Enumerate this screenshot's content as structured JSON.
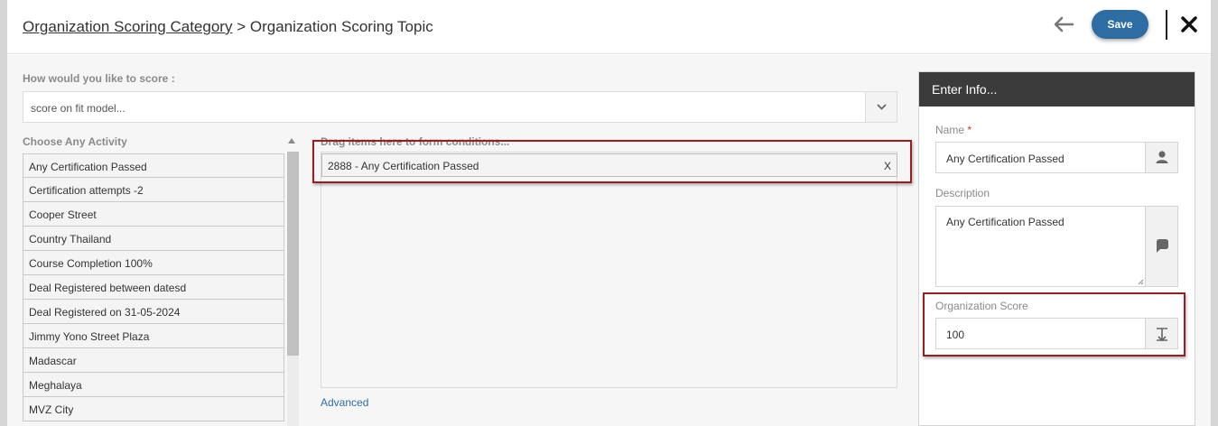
{
  "header": {
    "breadcrumb_parent": "Organization Scoring Category",
    "breadcrumb_separator": ">",
    "breadcrumb_current": "Organization Scoring Topic",
    "save_label": "Save"
  },
  "scoring": {
    "question_label": "How would you like to score :",
    "selected_value": "score on fit model..."
  },
  "activities": {
    "label": "Choose Any Activity",
    "items": [
      "Any Certification Passed",
      "Certification attempts -2",
      "Cooper Street",
      "Country Thailand",
      "Course Completion 100%",
      "Deal Registered between datesd",
      "Deal Registered on 31-05-2024",
      "Jimmy Yono Street Plaza",
      "Madascar",
      "Meghalaya",
      "MVZ City"
    ]
  },
  "conditions": {
    "label": "Drag items here to form conditions...",
    "items": [
      {
        "text": "2888 - Any Certification Passed",
        "remove_label": "X"
      }
    ],
    "advanced_label": "Advanced"
  },
  "info": {
    "title": "Enter Info...",
    "name_label": "Name",
    "name_required_mark": "*",
    "name_value": "Any Certification Passed",
    "description_label": "Description",
    "description_value": "Any Certification Passed",
    "score_label": "Organization Score",
    "score_value": "100"
  },
  "icons": {
    "back": "arrow-left-icon",
    "close": "close-icon",
    "caret": "chevron-down-icon",
    "user": "user-icon",
    "comment": "comment-icon",
    "number": "number-format-icon"
  },
  "colors": {
    "primary": "#2e6da4",
    "panel_header": "#3b3b3b",
    "highlight": "#9b1c22",
    "required": "#c0392b"
  }
}
